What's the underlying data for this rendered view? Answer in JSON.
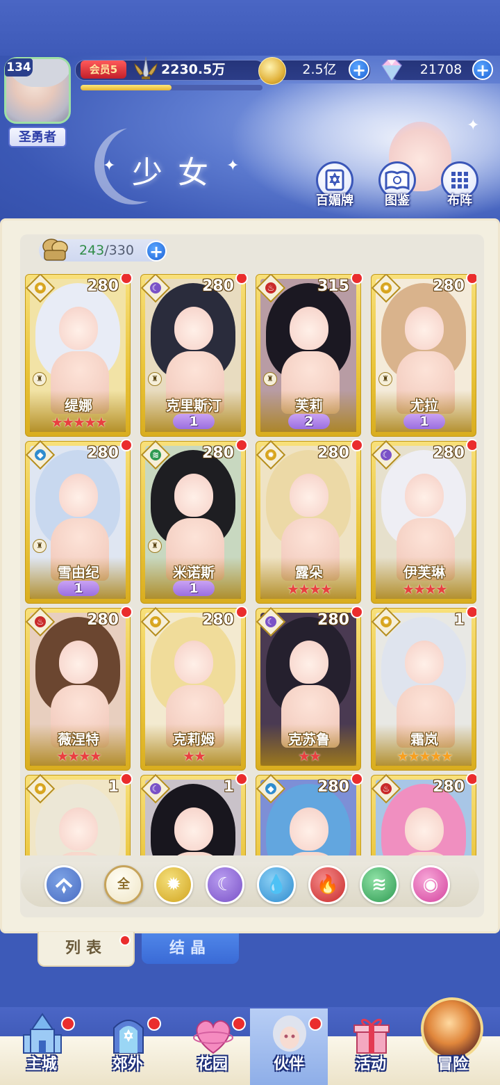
{
  "header": {
    "level": "134",
    "title_badge": "圣勇者",
    "vip": "会员5",
    "power": "2230.5万",
    "exp_progress": 0.5,
    "gold": "2.5亿",
    "gems": "21708",
    "page_title": "少女",
    "buttons": [
      {
        "label": "百媚牌",
        "icon": "star-of-david-book-icon"
      },
      {
        "label": "图鉴",
        "icon": "open-book-icon"
      },
      {
        "label": "布阵",
        "icon": "grid-formation-icon"
      }
    ]
  },
  "capacity": {
    "current": "243",
    "separator": "/330"
  },
  "cards": [
    {
      "name": "缇娜",
      "level": "280",
      "element": "sun",
      "stars": 5,
      "star_color": "red",
      "wings": null,
      "rank": true,
      "hair": "#e8ecf6",
      "bg": "#f2e3a6"
    },
    {
      "name": "克里斯汀",
      "level": "280",
      "element": "moon",
      "stars": 0,
      "star_color": "red",
      "wings": "1",
      "rank": true,
      "hair": "#2a2c3c",
      "bg": "#e8dcc0"
    },
    {
      "name": "芙莉",
      "level": "315",
      "element": "fire",
      "stars": 0,
      "star_color": "red",
      "wings": "2",
      "rank": true,
      "hair": "#1b1822",
      "bg": "#b89ca4"
    },
    {
      "name": "尤拉",
      "level": "280",
      "element": "sun",
      "stars": 0,
      "star_color": "red",
      "wings": "1",
      "rank": true,
      "hair": "#d9b38c",
      "bg": "#f4ebda"
    },
    {
      "name": "雪由纪",
      "level": "280",
      "element": "water",
      "stars": 0,
      "star_color": "red",
      "wings": "1",
      "rank": true,
      "hair": "#c8d8ef",
      "bg": "#dfe6f2"
    },
    {
      "name": "米诺斯",
      "level": "280",
      "element": "wind",
      "stars": 0,
      "star_color": "red",
      "wings": "1",
      "rank": true,
      "hair": "#1e1e22",
      "bg": "#c8d8c0"
    },
    {
      "name": "露朵",
      "level": "280",
      "element": "sun",
      "stars": 4,
      "star_color": "red",
      "wings": null,
      "rank": false,
      "hair": "#ecd9a6",
      "bg": "#efe3c4"
    },
    {
      "name": "伊芙琳",
      "level": "280",
      "element": "moon",
      "stars": 4,
      "star_color": "red",
      "wings": null,
      "rank": false,
      "hair": "#eeeef4",
      "bg": "#e6e0cc"
    },
    {
      "name": "薇涅特",
      "level": "280",
      "element": "fire",
      "stars": 4,
      "star_color": "red",
      "wings": null,
      "rank": false,
      "hair": "#6b4630",
      "bg": "#e8cfbf"
    },
    {
      "name": "克莉姆",
      "level": "280",
      "element": "sun",
      "stars": 2,
      "star_color": "red",
      "wings": null,
      "rank": false,
      "hair": "#f0dc9a",
      "bg": "#f3ead0"
    },
    {
      "name": "克苏鲁",
      "level": "280",
      "element": "moon",
      "stars": 2,
      "star_color": "red",
      "wings": null,
      "rank": false,
      "hair": "#25202e",
      "bg": "#4a3a52"
    },
    {
      "name": "霜岚",
      "level": "1",
      "element": "sun",
      "stars": 5,
      "star_color": "gold",
      "wings": null,
      "rank": false,
      "hair": "#dfe4ee",
      "bg": "#e8e8e4"
    },
    {
      "name": "",
      "level": "1",
      "element": "sun",
      "stars": 0,
      "star_color": "red",
      "wings": null,
      "rank": false,
      "hair": "#ece7d6",
      "bg": "#f1e6c6"
    },
    {
      "name": "",
      "level": "1",
      "element": "moon",
      "stars": 0,
      "star_color": "red",
      "wings": null,
      "rank": false,
      "hair": "#18161e",
      "bg": "#c9c2c9"
    },
    {
      "name": "",
      "level": "280",
      "element": "water",
      "stars": 0,
      "star_color": "red",
      "wings": null,
      "rank": false,
      "hair": "#62a6df",
      "bg": "#7d8fd6"
    },
    {
      "name": "",
      "level": "280",
      "element": "fire",
      "stars": 0,
      "star_color": "red",
      "wings": null,
      "rank": false,
      "hair": "#f08fc0",
      "bg": "#a8c6e6"
    }
  ],
  "filters": {
    "all": "全"
  },
  "tabs": {
    "list": "列表",
    "crystal": "结晶"
  },
  "nav": [
    {
      "label": "主城",
      "icon": "castle-icon",
      "badge": true
    },
    {
      "label": "郊外",
      "icon": "portal-gate-icon",
      "badge": true
    },
    {
      "label": "花园",
      "icon": "heart-icon",
      "badge": true
    },
    {
      "label": "伙伴",
      "icon": "partner-portrait-icon",
      "badge": true,
      "active": true
    },
    {
      "label": "活动",
      "icon": "gift-box-icon",
      "badge": false
    },
    {
      "label": "冒险",
      "icon": "adventure-orb-icon",
      "badge": false
    }
  ],
  "colors": {
    "element_sun": "#d8a51f",
    "element_moon": "#7a52c7",
    "element_fire": "#c92a2a",
    "element_water": "#2f8ccf",
    "element_wind": "#2f9a52",
    "card_gold": "#e9c338",
    "badge_red": "#ea2d2d"
  }
}
